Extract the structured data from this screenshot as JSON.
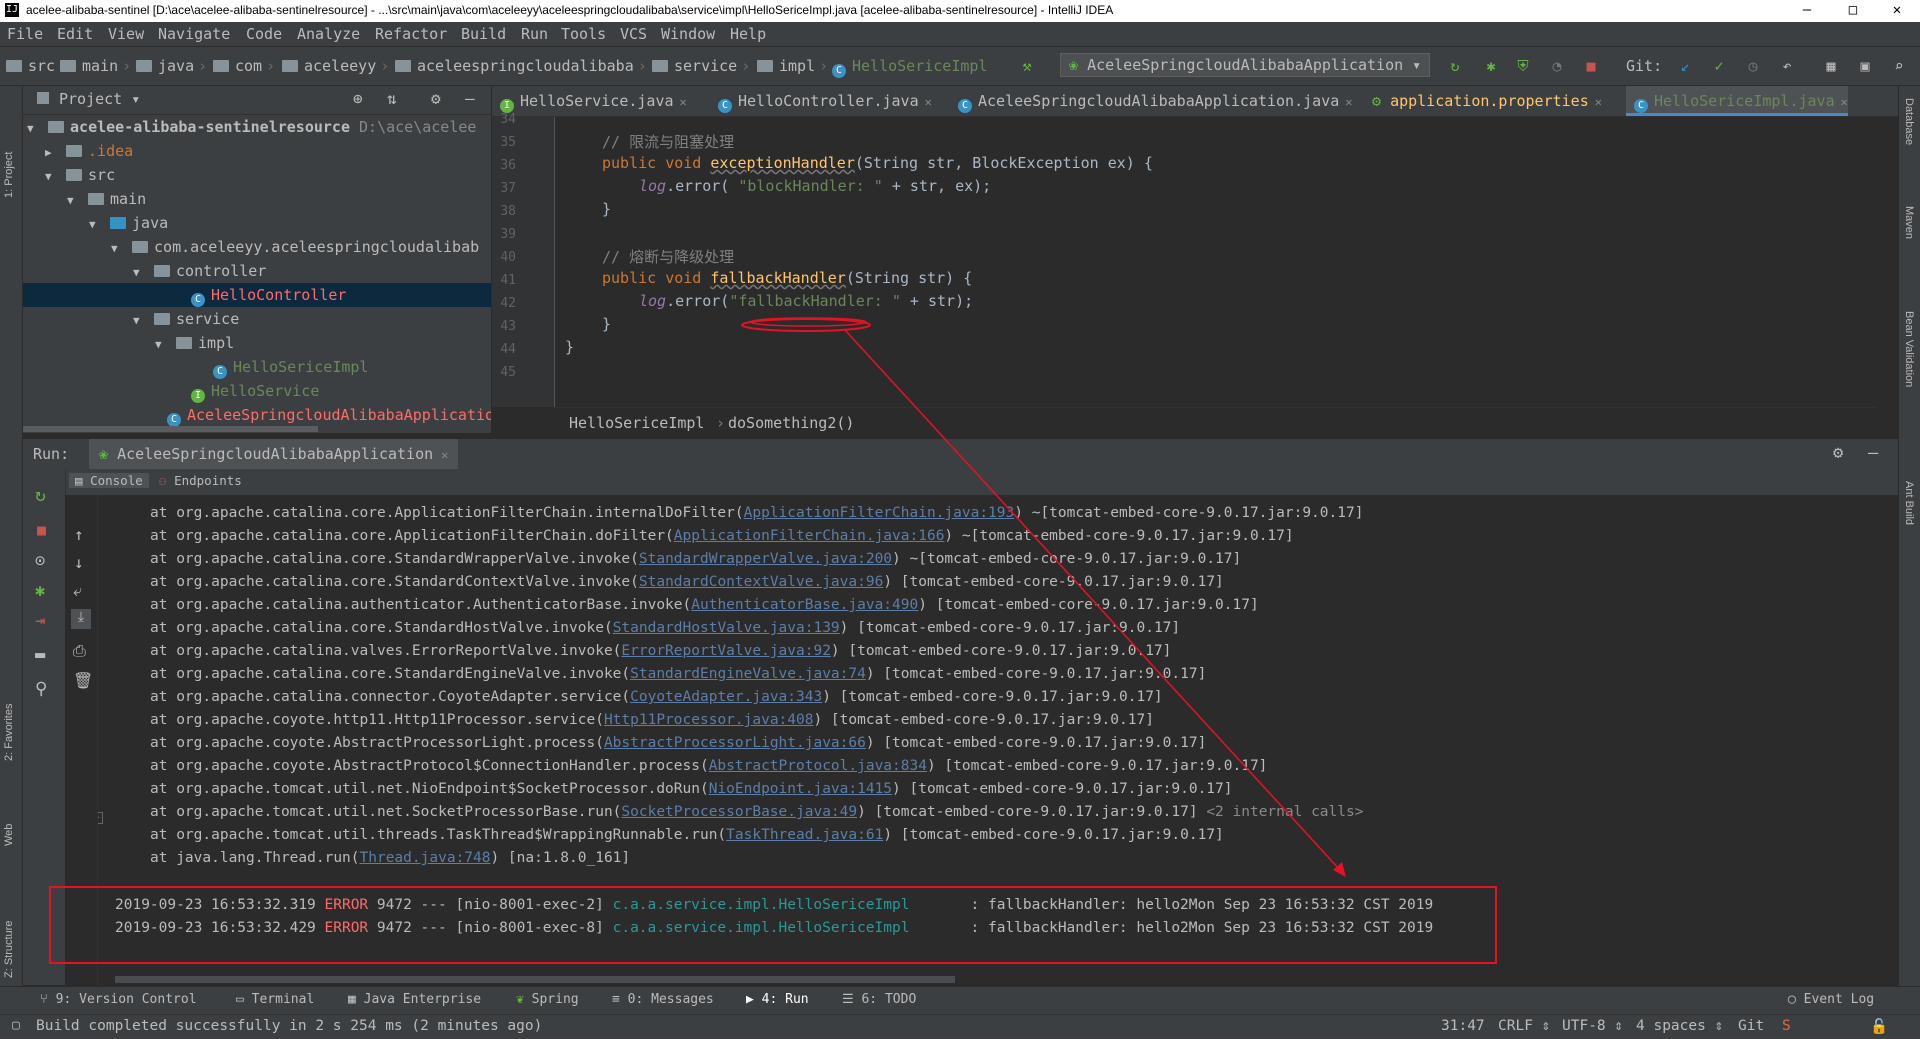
{
  "window": {
    "title": "acelee-alibaba-sentinel [D:\\ace\\acelee-alibaba-sentinelresource] - ...\\src\\main\\java\\com\\aceleeyy\\aceleespringcloudalibaba\\service\\impl\\HelloSericeImpl.java [acelee-alibaba-sentinelresource] - IntelliJ IDEA",
    "controls": [
      "–",
      "□",
      "✕"
    ]
  },
  "menu": [
    "File",
    "Edit",
    "View",
    "Navigate",
    "Code",
    "Analyze",
    "Refactor",
    "Build",
    "Run",
    "Tools",
    "VCS",
    "Window",
    "Help"
  ],
  "navbar": {
    "crumbs": [
      "src",
      "main",
      "java",
      "com",
      "aceleeyy",
      "aceleespringcloudalibaba",
      "service",
      "impl",
      "HelloSericeImpl"
    ],
    "run_config": "AceleeSpringcloudAlibabaApplication",
    "git_label": "Git:"
  },
  "left_strip": [
    "1: Project",
    "2: Favorites",
    "Web",
    "Z: Structure"
  ],
  "right_strip": [
    "Database",
    "Maven",
    "Bean Validation",
    "Ant Build"
  ],
  "project": {
    "title": "Project",
    "rows": [
      {
        "label": "acelee-alibaba-sentinelresource",
        "extra": "D:\\ace\\acelee"
      },
      {
        "label": ".idea"
      },
      {
        "label": "src"
      },
      {
        "label": "main"
      },
      {
        "label": "java"
      },
      {
        "label": "com.aceleeyy.aceleespringcloudalibab"
      },
      {
        "label": "controller"
      },
      {
        "label": "HelloController"
      },
      {
        "label": "service"
      },
      {
        "label": "impl"
      },
      {
        "label": "HelloSericeImpl"
      },
      {
        "label": "HelloService"
      },
      {
        "label": "AceleeSpringcloudAlibabaApplicatio"
      }
    ]
  },
  "tabs": [
    "HelloService.java",
    "HelloController.java",
    "AceleeSpringcloudAlibabaApplication.java",
    "application.properties",
    "HelloSericeImpl.java"
  ],
  "editor": {
    "line_numbers": [
      "34",
      "35",
      "36",
      "37",
      "38",
      "39",
      "40",
      "41",
      "42",
      "43",
      "44",
      "45"
    ],
    "comment1": "// 限流与阻塞处理",
    "l36_kw": "public void ",
    "l36_fn": "exceptionHandler",
    "l36_rest": "(String str, BlockException ex) {",
    "l37_log": "log",
    "l37_a": ".error( ",
    "l37_str": "\"blockHandler: \"",
    "l37_b": " + str, ex);",
    "l38": "}",
    "comment2": "// 熔断与降级处理",
    "l41_kw": "public void ",
    "l41_fn": "fallbackHandler",
    "l41_rest": "(String str) {",
    "l42_log": "log",
    "l42_a": ".error(",
    "l42_str": "\"fallbackHandler: \"",
    "l42_b": " + str);",
    "l43": "}",
    "l44": "}",
    "breadcrumb_class": "HelloSericeImpl",
    "breadcrumb_method": "doSomething2()"
  },
  "run": {
    "label": "Run:",
    "config_tab": "AceleeSpringcloudAlibabaApplication",
    "console_tab": "Console",
    "endpoints_tab": "Endpoints",
    "trace": [
      {
        "pre": "at org.apache.catalina.core.ApplicationFilterChain.internalDoFilter(",
        "link": "ApplicationFilterChain.java:193",
        "post": ") ~[tomcat-embed-core-9.0.17.jar:9.0.17]"
      },
      {
        "pre": "at org.apache.catalina.core.ApplicationFilterChain.doFilter(",
        "link": "ApplicationFilterChain.java:166",
        "post": ") ~[tomcat-embed-core-9.0.17.jar:9.0.17]"
      },
      {
        "pre": "at org.apache.catalina.core.StandardWrapperValve.invoke(",
        "link": "StandardWrapperValve.java:200",
        "post": ") ~[tomcat-embed-core-9.0.17.jar:9.0.17]"
      },
      {
        "pre": "at org.apache.catalina.core.StandardContextValve.invoke(",
        "link": "StandardContextValve.java:96",
        "post": ") [tomcat-embed-core-9.0.17.jar:9.0.17]"
      },
      {
        "pre": "at org.apache.catalina.authenticator.AuthenticatorBase.invoke(",
        "link": "AuthenticatorBase.java:490",
        "post": ") [tomcat-embed-core-9.0.17.jar:9.0.17]"
      },
      {
        "pre": "at org.apache.catalina.core.StandardHostValve.invoke(",
        "link": "StandardHostValve.java:139",
        "post": ") [tomcat-embed-core-9.0.17.jar:9.0.17]"
      },
      {
        "pre": "at org.apache.catalina.valves.ErrorReportValve.invoke(",
        "link": "ErrorReportValve.java:92",
        "post": ") [tomcat-embed-core-9.0.17.jar:9.0.17]"
      },
      {
        "pre": "at org.apache.catalina.core.StandardEngineValve.invoke(",
        "link": "StandardEngineValve.java:74",
        "post": ") [tomcat-embed-core-9.0.17.jar:9.0.17]"
      },
      {
        "pre": "at org.apache.catalina.connector.CoyoteAdapter.service(",
        "link": "CoyoteAdapter.java:343",
        "post": ") [tomcat-embed-core-9.0.17.jar:9.0.17]"
      },
      {
        "pre": "at org.apache.coyote.http11.Http11Processor.service(",
        "link": "Http11Processor.java:408",
        "post": ") [tomcat-embed-core-9.0.17.jar:9.0.17]"
      },
      {
        "pre": "at org.apache.coyote.AbstractProcessorLight.process(",
        "link": "AbstractProcessorLight.java:66",
        "post": ") [tomcat-embed-core-9.0.17.jar:9.0.17]"
      },
      {
        "pre": "at org.apache.coyote.AbstractProtocol$ConnectionHandler.process(",
        "link": "AbstractProtocol.java:834",
        "post": ") [tomcat-embed-core-9.0.17.jar:9.0.17]"
      },
      {
        "pre": "at org.apache.tomcat.util.net.NioEndpoint$SocketProcessor.doRun(",
        "link": "NioEndpoint.java:1415",
        "post": ") [tomcat-embed-core-9.0.17.jar:9.0.17]"
      },
      {
        "pre": "at org.apache.tomcat.util.net.SocketProcessorBase.run(",
        "link": "SocketProcessorBase.java:49",
        "post": ") [tomcat-embed-core-9.0.17.jar:9.0.17] ",
        "gray": "<2 internal calls>"
      },
      {
        "pre": "at org.apache.tomcat.util.threads.TaskThread$WrappingRunnable.run(",
        "link": "TaskThread.java:61",
        "post": ") [tomcat-embed-core-9.0.17.jar:9.0.17]"
      },
      {
        "pre": "at java.lang.Thread.run(",
        "link": "Thread.java:748",
        "post": ") [na:1.8.0_161]"
      }
    ],
    "logs": [
      {
        "ts": "2019-09-23 16:53:32.319 ",
        "level": "ERROR",
        "mid": " 9472 --- [nio-8001-exec-2] ",
        "cls": "c.a.a.service.impl.HelloSericeImpl",
        "msg": "       : fallbackHandler: hello2Mon Sep 23 16:53:32 CST 2019"
      },
      {
        "ts": "2019-09-23 16:53:32.429 ",
        "level": "ERROR",
        "mid": " 9472 --- [nio-8001-exec-8] ",
        "cls": "c.a.a.service.impl.HelloSericeImpl",
        "msg": "       : fallbackHandler: hello2Mon Sep 23 16:53:32 CST 2019"
      }
    ]
  },
  "tool_windows": [
    "9: Version Control",
    "Terminal",
    "Java Enterprise",
    "Spring",
    "0: Messages",
    "4: Run",
    "6: TODO",
    "Event Log"
  ],
  "status": {
    "message": "Build completed successfully in 2 s 254 ms (2 minutes ago)",
    "position": "31:47",
    "line_sep": "CRLF",
    "encoding": "UTF-8",
    "indent": "4 spaces",
    "vcs": "Git"
  },
  "colors": {
    "annotation_red": "#e81123",
    "error": "#ff6b68",
    "logger_class": "#299999",
    "selection": "#0d293e"
  }
}
